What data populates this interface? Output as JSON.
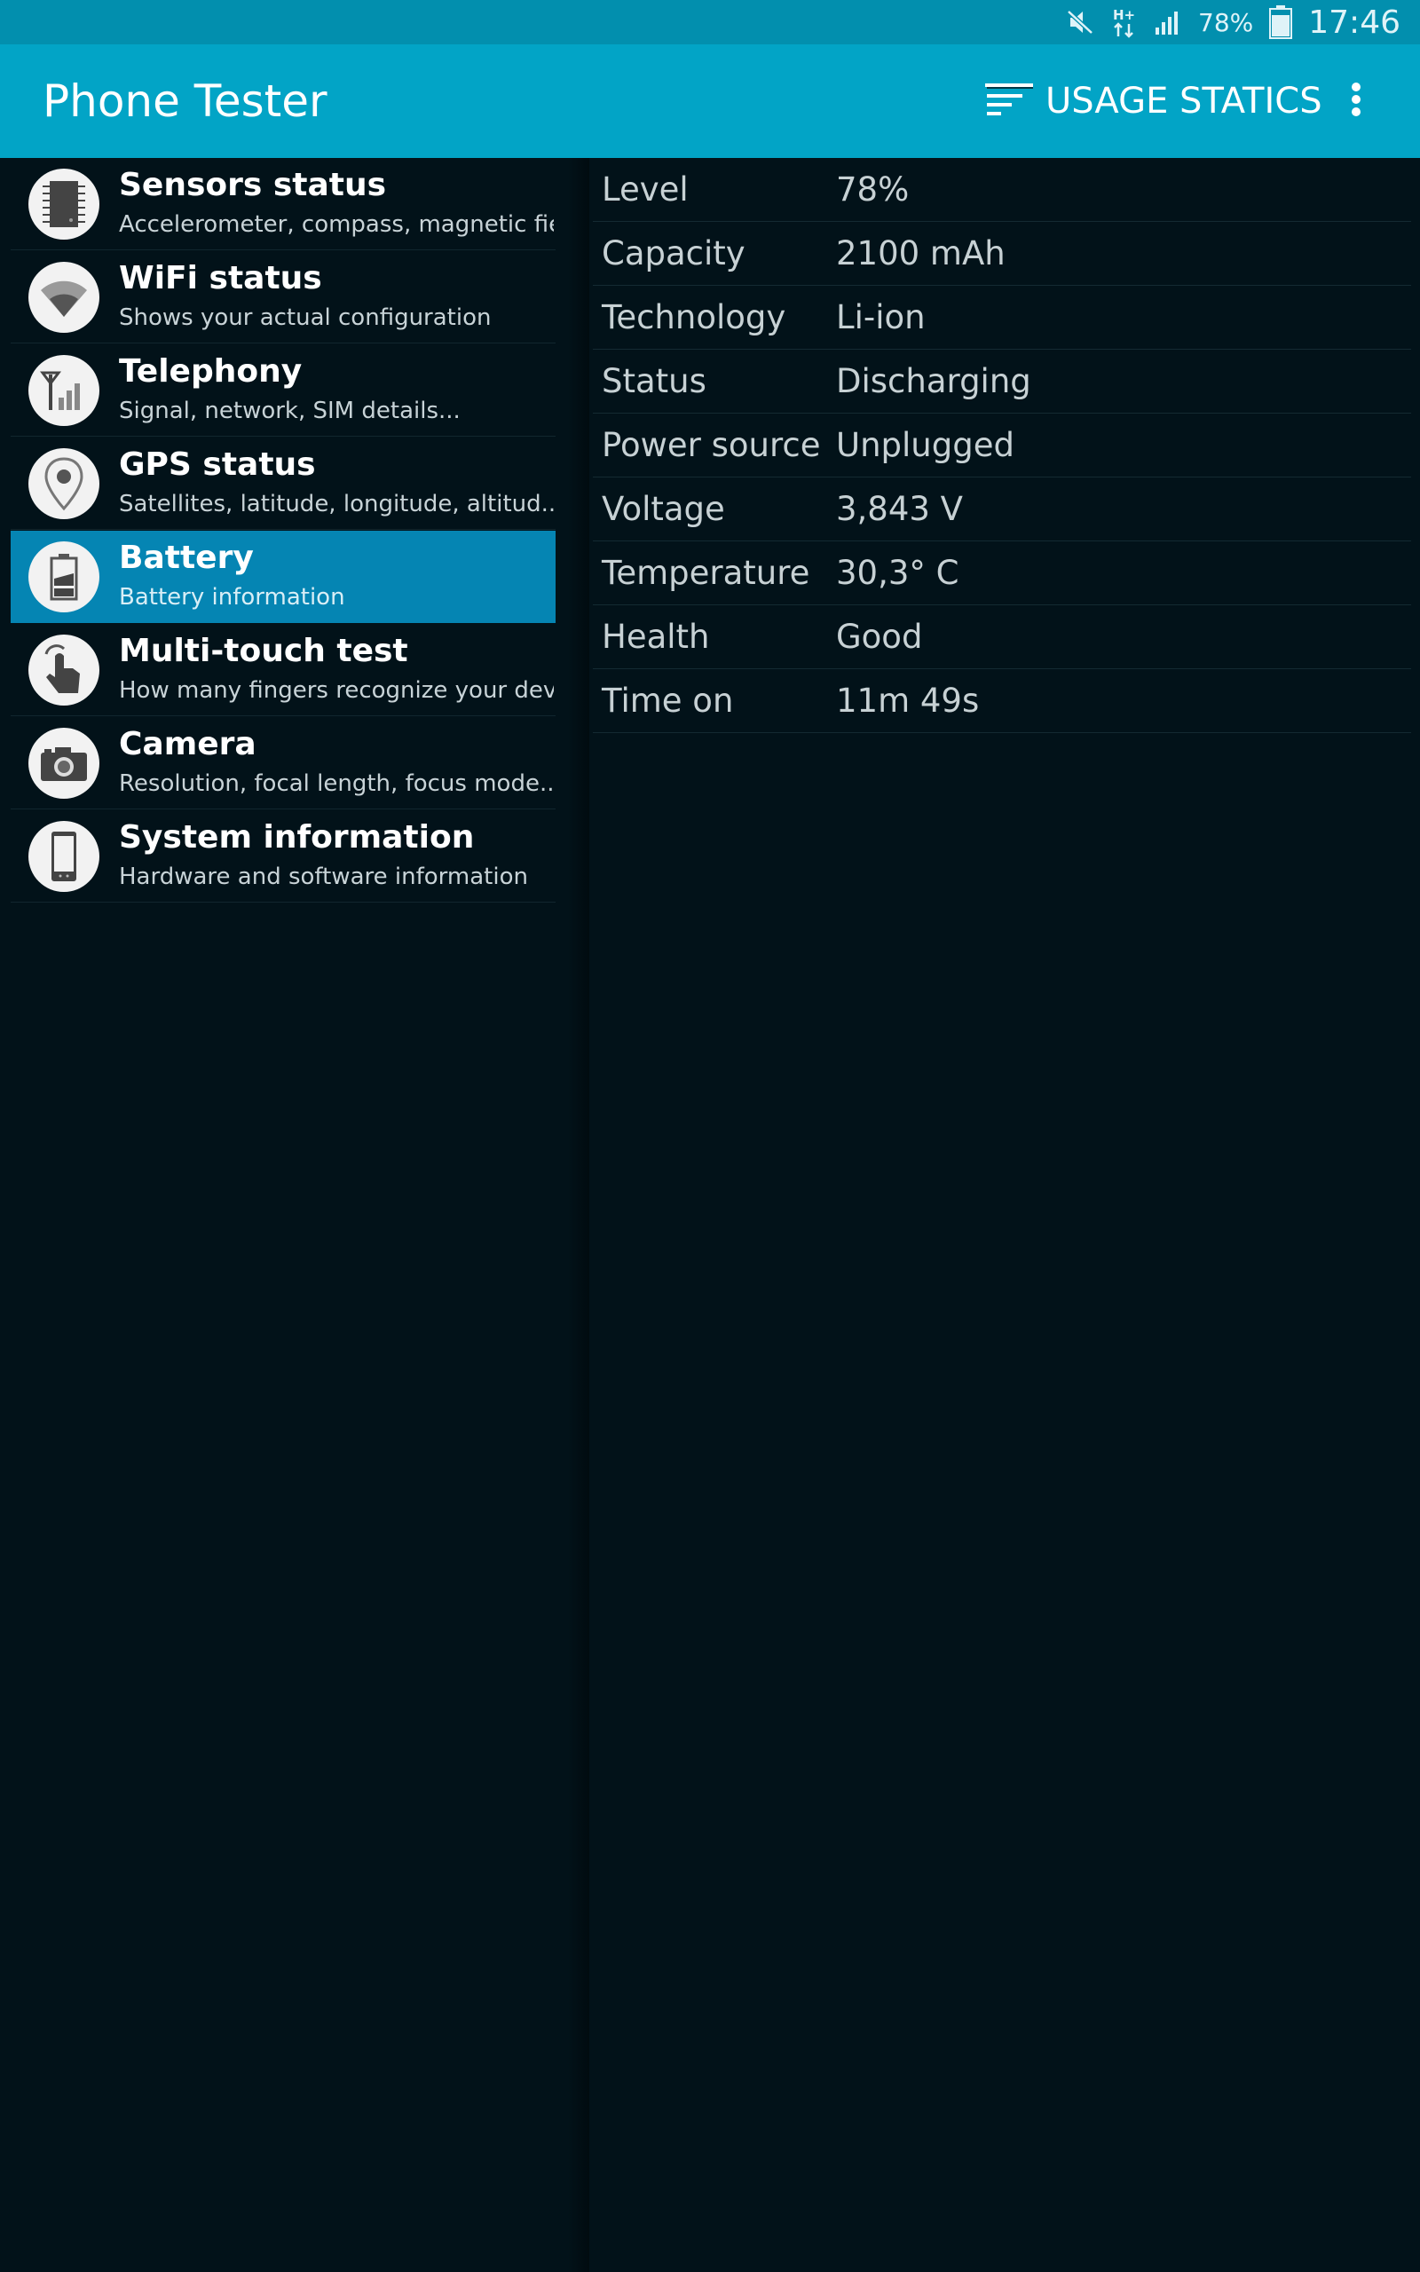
{
  "status_bar": {
    "battery_percent": "78%",
    "time": "17:46",
    "network_type": "H+",
    "icons": [
      "mute-icon",
      "data-activity-icon",
      "signal-icon",
      "battery-icon"
    ]
  },
  "app_bar": {
    "title": "Phone Tester",
    "usage_button_label": "USAGE STATICS",
    "accent_color": "#02a4c6"
  },
  "menu": {
    "selected_color": "#0585b3",
    "items": [
      {
        "title": "Sensors status",
        "subtitle": "Accelerometer, compass, magnetic fie...",
        "icon": "chip-icon"
      },
      {
        "title": "WiFi status",
        "subtitle": "Shows your actual configuration",
        "icon": "wifi-icon"
      },
      {
        "title": "Telephony",
        "subtitle": "Signal, network, SIM details...",
        "icon": "antenna-signal-icon"
      },
      {
        "title": "GPS status",
        "subtitle": "Satellites, latitude, longitude, altitud...",
        "icon": "location-pin-icon"
      },
      {
        "title": "Battery",
        "subtitle": "Battery information",
        "icon": "battery-icon",
        "selected": true
      },
      {
        "title": "Multi-touch test",
        "subtitle": "How many fingers recognize your devi...",
        "icon": "touch-hand-icon"
      },
      {
        "title": "Camera",
        "subtitle": "Resolution, focal length, focus mode...",
        "icon": "camera-icon"
      },
      {
        "title": "System information",
        "subtitle": "Hardware and software information",
        "icon": "device-icon"
      }
    ]
  },
  "battery_info": [
    {
      "label": "Level",
      "value": "78%"
    },
    {
      "label": "Capacity",
      "value": "2100 mAh"
    },
    {
      "label": "Technology",
      "value": "Li-ion"
    },
    {
      "label": "Status",
      "value": "Discharging"
    },
    {
      "label": "Power source",
      "value": "Unplugged"
    },
    {
      "label": "Voltage",
      "value": "3,843 V"
    },
    {
      "label": "Temperature",
      "value": "30,3° C"
    },
    {
      "label": "Health",
      "value": "Good"
    },
    {
      "label": "Time on",
      "value": "11m 49s"
    }
  ]
}
